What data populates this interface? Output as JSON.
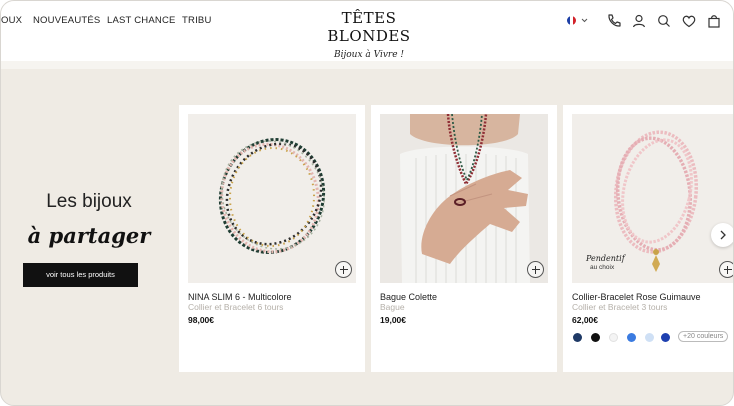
{
  "header": {
    "nav": [
      "OUX",
      "NOUVEAUTÉS",
      "LAST CHANCE",
      "TRIBU"
    ],
    "logo": "TÊTES BLONDES",
    "tagline": "Bijoux à Vivre !",
    "icons": [
      "france-flag-icon",
      "chevron-down-icon",
      "phone-icon",
      "account-icon",
      "search-icon",
      "heart-icon",
      "bag-icon"
    ]
  },
  "promo": {
    "line1": "Les bijoux",
    "line2": "à partager",
    "button": "voir tous les produits"
  },
  "products": [
    {
      "title": "NINA SLIM 6 - Multicolore",
      "subtitle": "Collier et Bracelet 6 tours",
      "price": "98,00€"
    },
    {
      "title": "Bague Colette",
      "subtitle": "Bague",
      "price": "19,00€"
    },
    {
      "title": "Collier-Bracelet Rose Guimauve",
      "subtitle": "Collier et Bracelet 3 tours",
      "price": "62,00€",
      "overlay_title": "Pendentif",
      "overlay_sub": "au choix",
      "swatches": [
        "#1f3a66",
        "#111111",
        "#f4f4f4",
        "#3b7be0",
        "#cfe0f5",
        "#1e40b0"
      ],
      "more_colors": "+20 couleurs"
    }
  ],
  "colors": {
    "background": "#efebe4",
    "card": "#ffffff",
    "button": "#111111"
  }
}
